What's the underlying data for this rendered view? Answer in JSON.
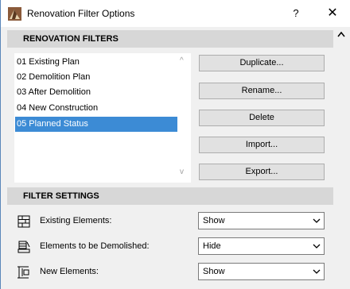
{
  "window": {
    "title": "Renovation Filter Options",
    "help_label": "?",
    "close_label": "✕"
  },
  "renovation_filters": {
    "header": "RENOVATION FILTERS",
    "items": [
      {
        "label": "01 Existing Plan",
        "selected": false
      },
      {
        "label": "02 Demolition Plan",
        "selected": false
      },
      {
        "label": "03 After Demolition",
        "selected": false
      },
      {
        "label": "04 New Construction",
        "selected": false
      },
      {
        "label": "05 Planned Status",
        "selected": true
      }
    ],
    "scroll_up": "^",
    "scroll_down": "v",
    "buttons": {
      "duplicate": "Duplicate...",
      "rename": "Rename...",
      "delete": "Delete",
      "import": "Import...",
      "export": "Export..."
    }
  },
  "filter_settings": {
    "header": "FILTER SETTINGS",
    "rows": [
      {
        "label": "Existing Elements:",
        "value": "Show",
        "icon": "existing-elements-icon"
      },
      {
        "label": "Elements to be Demolished:",
        "value": "Hide",
        "icon": "demolished-elements-icon"
      },
      {
        "label": "New Elements:",
        "value": "Show",
        "icon": "new-elements-icon"
      }
    ]
  },
  "colors": {
    "selection": "#3c8bd5",
    "section_header": "#d7d7d7",
    "window_bg": "#f0f0f0"
  }
}
